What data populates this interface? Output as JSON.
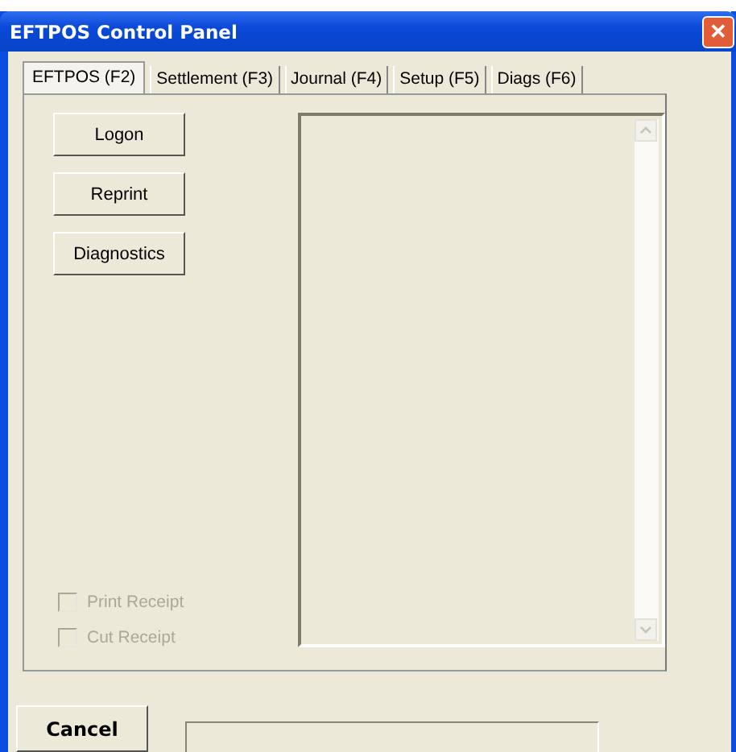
{
  "window": {
    "title": "EFTPOS Control Panel",
    "close": "✕"
  },
  "tabs": [
    {
      "label": "EFTPOS (F2)",
      "selected": true
    },
    {
      "label": "Settlement (F3)",
      "selected": false
    },
    {
      "label": "Journal (F4)",
      "selected": false
    },
    {
      "label": "Setup (F5)",
      "selected": false
    },
    {
      "label": "Diags (F6)",
      "selected": false
    }
  ],
  "actions": [
    "Logon",
    "Reprint",
    "Diagnostics"
  ],
  "options": [
    {
      "label": "Print Receipt",
      "checked": false,
      "disabled": true
    },
    {
      "label": "Cut Receipt",
      "checked": false,
      "disabled": true
    }
  ],
  "cancel": "Cancel"
}
